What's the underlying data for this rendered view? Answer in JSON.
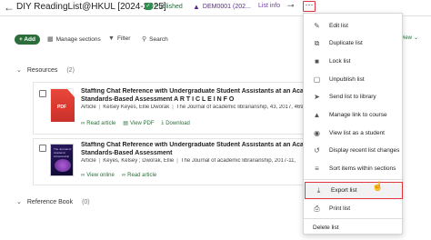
{
  "topbar": {
    "back_icon": "arrow-left-icon",
    "title": "DIY ReadingList@HKUL [2024-2025]",
    "published": "Published",
    "course_code": "DEM0001 (202...",
    "list_info": "List info",
    "share_icon": "share-icon",
    "more_icon": "more-horizontal-icon"
  },
  "toolbar": {
    "add_label": "+ Add",
    "manage_sections": "Manage sections",
    "filter": "Filter",
    "search": "Search",
    "edit_tail": "d view"
  },
  "sections": [
    {
      "name": "Resources",
      "count": "(2)",
      "items": [
        {
          "title_line1": "Staffing Chat Reference with Undergraduate Student Assistants at an Academic Lil",
          "title_line2": "Standards-Based Assessment A R T I C L E I N F O",
          "type": "Article",
          "authors": "Kelsey Keyes, Ellie Dworak",
          "source": "The Journal of academic librarianship, 43, 2017, 469",
          "actions": [
            "Read article",
            "View PDF",
            "Download"
          ]
        },
        {
          "title_line1": "Staffing Chat Reference with Undergraduate Student Assistants at an Academic Lil",
          "title_line2": "Standards-Based Assessment",
          "type": "Article",
          "authors": "Keyes, Kelsey ; Dworak, Ellie",
          "source": "The Journal of academic librarianship, 2017-11,",
          "actions": [
            "View online",
            "Read article"
          ]
        }
      ]
    },
    {
      "name": "Reference Book",
      "count": "(0)"
    }
  ],
  "menu": {
    "items": [
      {
        "label": "Edit list",
        "icon": "pencil-icon"
      },
      {
        "label": "Duplicate list",
        "icon": "copy-icon"
      },
      {
        "label": "Lock list",
        "icon": "lock-icon"
      },
      {
        "label": "Unpublish list",
        "icon": "unpublish-icon"
      },
      {
        "label": "Send list to library",
        "icon": "send-icon"
      },
      {
        "label": "Manage link to course",
        "icon": "mortarboard-icon"
      },
      {
        "label": "View list as a student",
        "icon": "eye-icon"
      },
      {
        "label": "Display recent list changes",
        "icon": "history-icon"
      },
      {
        "label": "Sort items within sections",
        "icon": "sort-icon"
      },
      {
        "label": "Export list",
        "icon": "download-icon"
      },
      {
        "label": "Print list",
        "icon": "printer-icon"
      },
      {
        "label": "Delete list",
        "icon": ""
      }
    ],
    "highlighted": "Export list"
  }
}
